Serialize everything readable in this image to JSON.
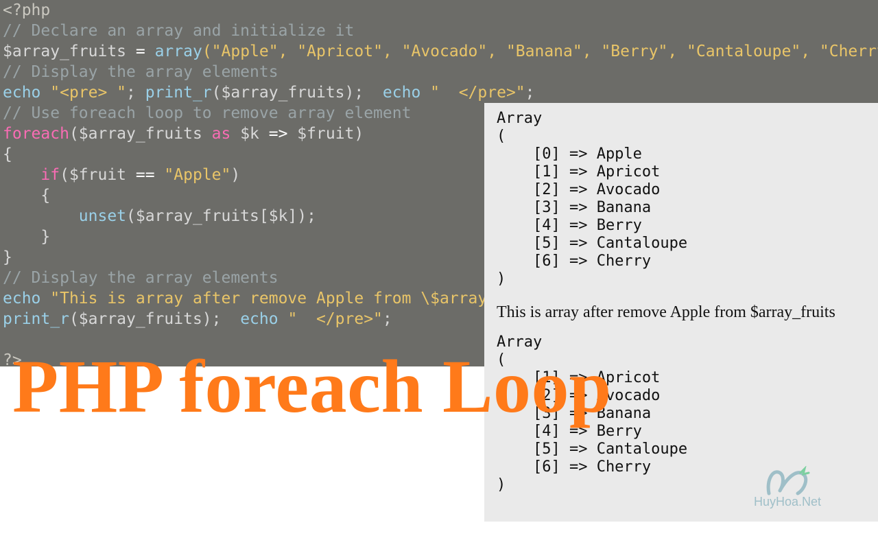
{
  "title": "PHP foreach Loop",
  "watermark": "HuyHoa.Net",
  "output": {
    "array1_header": "Array",
    "array1_open": "(",
    "array1_items": [
      "    [0] => Apple",
      "    [1] => Apricot",
      "    [2] => Avocado",
      "    [3] => Banana",
      "    [4] => Berry",
      "    [5] => Cantaloupe",
      "    [6] => Cherry"
    ],
    "array1_close": ")",
    "between_text": "This is array after remove Apple from $array_fruits",
    "array2_header": "Array",
    "array2_open": "(",
    "array2_items": [
      "    [1] => Apricot",
      "    [2] => Avocado",
      "    [3] => Banana",
      "    [4] => Berry",
      "    [5] => Cantaloupe",
      "    [6] => Cherry"
    ],
    "array2_close": ")"
  },
  "code": {
    "l0": "<?php",
    "l1": "// Declare an array and initialize it",
    "l2_pre": "$array_fruits ",
    "l2_eq": "=",
    "l2_arr": " array",
    "l2_args": "(\"Apple\", \"Apricot\", \"Avocado\", \"Banana\", \"Berry\", \"Cantaloupe\", \"Cherry\"",
    "l3": "// Display the array elements",
    "l4_a": "echo ",
    "l4_b": "\"<pre> \"",
    "l4_c": "; ",
    "l4_d": "print_r",
    "l4_e": "($array_fruits);  ",
    "l4_f": "echo ",
    "l4_g": "\"  </pre>\"",
    "l4_h": ";",
    "l5": "// Use foreach loop to remove array element",
    "l6_a": "foreach",
    "l6_b": "($array_fruits ",
    "l6_c": "as",
    "l6_d": " $k ",
    "l6_e": "=>",
    "l6_f": " $fruit)",
    "l7": "{",
    "l8_a": "    if",
    "l8_b": "($fruit ",
    "l8_c": "==",
    "l8_d": " \"Apple\"",
    "l8_e": ")",
    "l9": "    {",
    "l10_a": "        unset",
    "l10_b": "($array_fruits[$k]);",
    "l11": "    }",
    "l12": "}",
    "l13": "// Display the array elements",
    "l14_a": "echo ",
    "l14_b": "\"This is array after remove Apple from \\$array_fruits <pre> \"",
    "l14_c": ";",
    "l15_a": "print_r",
    "l15_b": "($array_fruits);  ",
    "l15_c": "echo ",
    "l15_d": "\"  </pre>\"",
    "l15_e": ";",
    "l16": "",
    "l17": "?>"
  }
}
